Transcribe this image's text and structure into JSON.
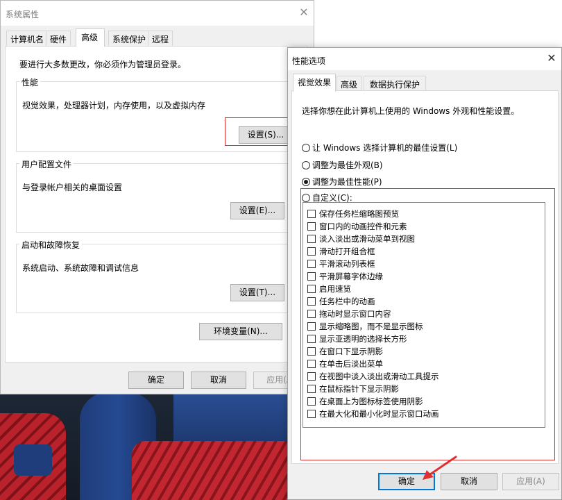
{
  "system_properties": {
    "title": "系统属性",
    "close_glyph": "✕",
    "tabs": [
      "计算机名",
      "硬件",
      "高级",
      "系统保护",
      "远程"
    ],
    "active_tab": "高级",
    "admin_note": "要进行大多数更改，你必须作为管理员登录。",
    "performance": {
      "title": "性能",
      "desc": "视觉效果，处理器计划，内存使用，以及虚拟内存",
      "button": "设置(S)..."
    },
    "user_profiles": {
      "title": "用户配置文件",
      "desc": "与登录帐户相关的桌面设置",
      "button": "设置(E)..."
    },
    "startup_recovery": {
      "title": "启动和故障恢复",
      "desc": "系统启动、系统故障和调试信息",
      "button": "设置(T)..."
    },
    "env_button": "环境变量(N)...",
    "ok": "确定",
    "cancel": "取消",
    "apply": "应用(A)"
  },
  "performance_options": {
    "title": "性能选项",
    "close_glyph": "✕",
    "tabs": [
      "视觉效果",
      "高级",
      "数据执行保护"
    ],
    "active_tab": "视觉效果",
    "intro": "选择你想在此计算机上使用的 Windows 外观和性能设置。",
    "radios": [
      {
        "label": "让 Windows 选择计算机的最佳设置(L)",
        "checked": false
      },
      {
        "label": "调整为最佳外观(B)",
        "checked": false
      },
      {
        "label": "调整为最佳性能(P)",
        "checked": true
      },
      {
        "label": "自定义(C):",
        "checked": false
      }
    ],
    "effects": [
      "保存任务栏缩略图预览",
      "窗口内的动画控件和元素",
      "淡入淡出或滑动菜单到视图",
      "滑动打开组合框",
      "平滑滚动列表框",
      "平滑屏幕字体边缘",
      "启用速览",
      "任务栏中的动画",
      "拖动时显示窗口内容",
      "显示缩略图，而不是显示图标",
      "显示亚透明的选择长方形",
      "在窗口下显示阴影",
      "在单击后淡出菜单",
      "在视图中淡入淡出或滑动工具提示",
      "在鼠标指针下显示阴影",
      "在桌面上为图标标签使用阴影",
      "在最大化和最小化时显示窗口动画"
    ],
    "ok": "确定",
    "cancel": "取消",
    "apply": "应用(A)"
  },
  "colors": {
    "highlight": "#e03030",
    "focus": "#0078d7"
  }
}
